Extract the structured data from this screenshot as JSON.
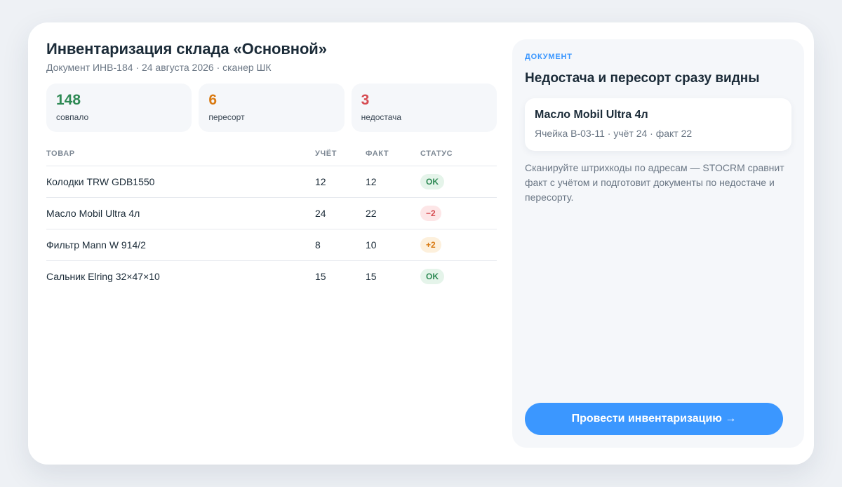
{
  "header": {
    "title": "Инвентаризация склада «Основной»",
    "subtitle": "Документ ИНВ-184 · 24 августа 2026 · сканер ШК"
  },
  "stats": [
    {
      "value": "148",
      "label": "совпало",
      "color": "#2f8a55"
    },
    {
      "value": "6",
      "label": "пересорт",
      "color": "#d97a12"
    },
    {
      "value": "3",
      "label": "недостача",
      "color": "#d64c52"
    }
  ],
  "table": {
    "columns": [
      "ТОВАР",
      "УЧЁТ",
      "ФАКТ",
      "СТАТУС"
    ],
    "rows": [
      {
        "name": "Колодки TRW GDB1550",
        "account": "12",
        "fact": "12",
        "status": "OK"
      },
      {
        "name": "Масло Mobil Ultra 4л",
        "account": "24",
        "fact": "22",
        "status": "−2"
      },
      {
        "name": "Фильтр Mann W 914/2",
        "account": "8",
        "fact": "10",
        "status": "+2"
      },
      {
        "name": "Сальник Elring 32×47×10",
        "account": "15",
        "fact": "15",
        "status": "OK"
      }
    ]
  },
  "panel": {
    "eyebrow": "ДОКУМЕНТ",
    "title": "Недостача и пересорт сразу видны",
    "item": {
      "name": "Масло Mobil Ultra 4л",
      "meta": "Ячейка B-03-11 · учёт 24 · факт 22"
    },
    "description": "Сканируйте штрихкоды по адресам — STOCRM сравнит факт с учётом и подготовит документы по недостаче и пересорту.",
    "cta_label": "Провести инвентаризацию →"
  },
  "colors": {
    "accent": "#3b97ff",
    "ok": "#2f8a55",
    "warning": "#d97a12",
    "danger": "#d64c52"
  }
}
